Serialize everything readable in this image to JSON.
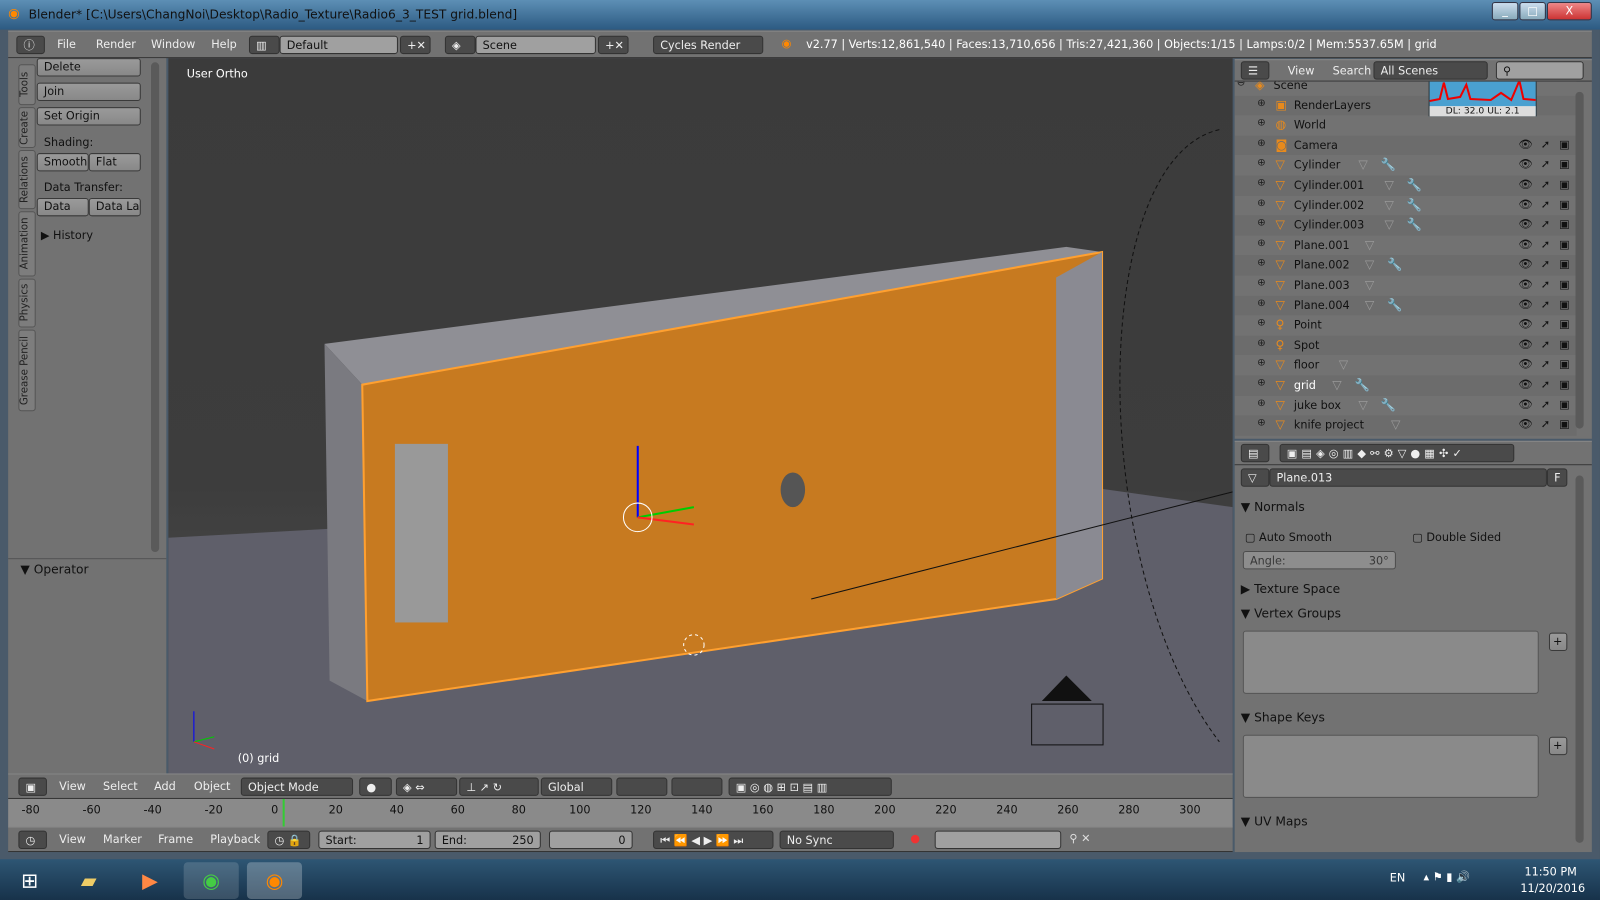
{
  "window": {
    "title": "Blender* [C:\\Users\\ChangNoi\\Desktop\\Radio_Texture\\Radio6_3_TEST grid.blend]",
    "minimize": "_",
    "maximize": "□",
    "close": "X"
  },
  "info_header": {
    "menus": [
      "File",
      "Render",
      "Window",
      "Help"
    ],
    "layout": "Default",
    "scene": "Scene",
    "engine": "Cycles Render",
    "stats": "v2.77 | Verts:12,861,540 | Faces:13,710,656 | Tris:27,421,360 | Objects:1/15 | Lamps:0/2 | Mem:5537.65M | grid"
  },
  "tool_tabs": [
    "Tools",
    "Create",
    "Relations",
    "Animation",
    "Physics",
    "Grease Pencil"
  ],
  "tools": {
    "delete": "Delete",
    "join": "Join",
    "set_origin": "Set Origin",
    "shading_label": "Shading:",
    "smooth": "Smooth",
    "flat": "Flat",
    "data_transfer_label": "Data Transfer:",
    "data": "Data",
    "data_layout": "Data La",
    "history": "History",
    "operator": "Operator"
  },
  "viewport": {
    "view_name": "User Ortho",
    "object_label": "(0) grid"
  },
  "view3d_header": {
    "menus": [
      "View",
      "Select",
      "Add",
      "Object"
    ],
    "mode": "Object Mode",
    "orientation": "Global"
  },
  "timeline": {
    "ticks": [
      -80,
      -60,
      -40,
      -20,
      0,
      20,
      40,
      60,
      80,
      100,
      120,
      140,
      160,
      180,
      200,
      220,
      240,
      260,
      280,
      300
    ],
    "current_frame": 0
  },
  "timeline_header": {
    "menus": [
      "View",
      "Marker",
      "Frame",
      "Playback"
    ],
    "start": "Start:",
    "start_val": "1",
    "end": "End:",
    "end_val": "250",
    "frame": "0",
    "sync": "No Sync"
  },
  "outliner": {
    "view": "View",
    "search": "Search",
    "filter": "All Scenes",
    "netmeter": "DL: 32.0 UL: 2.1",
    "items": [
      {
        "name": "Scene",
        "icon": "scene-icon",
        "level": 0
      },
      {
        "name": "RenderLayers",
        "icon": "render-layers-icon",
        "level": 1
      },
      {
        "name": "World",
        "icon": "world-icon",
        "level": 1
      },
      {
        "name": "Camera",
        "icon": "camera-icon",
        "level": 1
      },
      {
        "name": "Cylinder",
        "icon": "mesh-icon",
        "level": 1,
        "modifier": true
      },
      {
        "name": "Cylinder.001",
        "icon": "mesh-icon",
        "level": 1,
        "modifier": true
      },
      {
        "name": "Cylinder.002",
        "icon": "mesh-icon",
        "level": 1,
        "modifier": true
      },
      {
        "name": "Cylinder.003",
        "icon": "mesh-icon",
        "level": 1,
        "modifier": true
      },
      {
        "name": "Plane.001",
        "icon": "mesh-icon",
        "level": 1,
        "modifier": false
      },
      {
        "name": "Plane.002",
        "icon": "mesh-icon",
        "level": 1,
        "modifier": true
      },
      {
        "name": "Plane.003",
        "icon": "mesh-icon",
        "level": 1,
        "modifier": false
      },
      {
        "name": "Plane.004",
        "icon": "mesh-icon",
        "level": 1,
        "modifier": true
      },
      {
        "name": "Point",
        "icon": "lamp-icon",
        "level": 1
      },
      {
        "name": "Spot",
        "icon": "lamp-icon",
        "level": 1
      },
      {
        "name": "floor",
        "icon": "mesh-icon",
        "level": 1,
        "modifier": false
      },
      {
        "name": "grid",
        "icon": "mesh-icon",
        "level": 1,
        "modifier": true,
        "active": true
      },
      {
        "name": "juke box",
        "icon": "mesh-icon",
        "level": 1,
        "modifier": true
      },
      {
        "name": "knife project",
        "icon": "mesh-icon",
        "level": 1,
        "modifier": false
      }
    ]
  },
  "properties": {
    "datablock": "Plane.013",
    "fake_user": "F",
    "normals": "Normals",
    "auto_smooth": "Auto Smooth",
    "double_sided": "Double Sided",
    "angle": "Angle:",
    "angle_val": "30°",
    "texture_space": "Texture Space",
    "vertex_groups": "Vertex Groups",
    "shape_keys": "Shape Keys",
    "uv_maps": "UV Maps"
  },
  "taskbar": {
    "lang": "EN",
    "time": "11:50 PM",
    "date": "11/20/2016"
  },
  "colors": {
    "selection": "#f0901e",
    "header": "#727272",
    "viewport": "#3d3d3d"
  }
}
